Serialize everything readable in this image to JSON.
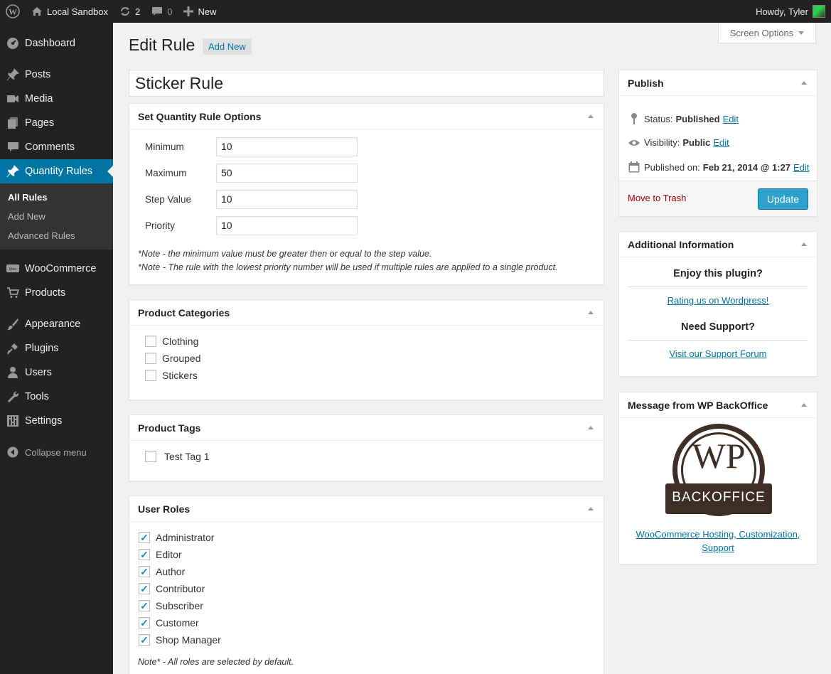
{
  "adminbar": {
    "site_name": "Local Sandbox",
    "updates_count": "2",
    "comments_count": "0",
    "new_label": "New",
    "howdy": "Howdy, Tyler"
  },
  "sidebar": {
    "items": [
      {
        "label": "Dashboard"
      },
      {
        "label": "Posts"
      },
      {
        "label": "Media"
      },
      {
        "label": "Pages"
      },
      {
        "label": "Comments"
      },
      {
        "label": "Quantity Rules"
      },
      {
        "label": "WooCommerce"
      },
      {
        "label": "Products"
      },
      {
        "label": "Appearance"
      },
      {
        "label": "Plugins"
      },
      {
        "label": "Users"
      },
      {
        "label": "Tools"
      },
      {
        "label": "Settings"
      }
    ],
    "submenu": [
      "All Rules",
      "Add New",
      "Advanced Rules"
    ],
    "collapse": "Collapse menu"
  },
  "header": {
    "screen_options": "Screen Options",
    "title": "Edit Rule",
    "add_new": "Add New"
  },
  "post_title": "Sticker Rule",
  "quantity_options": {
    "heading": "Set Quantity Rule Options",
    "fields": [
      {
        "label": "Minimum",
        "value": "10"
      },
      {
        "label": "Maximum",
        "value": "50"
      },
      {
        "label": "Step Value",
        "value": "10"
      },
      {
        "label": "Priority",
        "value": "10"
      }
    ],
    "note1": "*Note - the minimum value must be greater then or equal to the step value.",
    "note2": "*Note - The rule with the lowest priority number will be used if multiple rules are applied to a single product."
  },
  "categories": {
    "heading": "Product Categories",
    "items": [
      "Clothing",
      "Grouped",
      "Stickers"
    ]
  },
  "tags": {
    "heading": "Product Tags",
    "items": [
      "Test Tag 1"
    ]
  },
  "roles": {
    "heading": "User Roles",
    "items": [
      "Administrator",
      "Editor",
      "Author",
      "Contributor",
      "Subscriber",
      "Customer",
      "Shop Manager"
    ],
    "note": "Note* - All roles are selected by default."
  },
  "publish": {
    "heading": "Publish",
    "status_label": "Status:",
    "status_value": "Published",
    "visibility_label": "Visibility:",
    "visibility_value": "Public",
    "published_label": "Published on:",
    "published_value": "Feb 21, 2014 @ 1:27",
    "edit": "Edit",
    "trash": "Move to Trash",
    "update": "Update"
  },
  "additional": {
    "heading": "Additional Information",
    "enjoy": "Enjoy this plugin?",
    "rating_link": "Rating us on Wordpress!",
    "support": "Need Support?",
    "support_link": "Visit our Support Forum"
  },
  "backoffice": {
    "heading": "Message from WP BackOffice",
    "logo_wp": "WP",
    "logo_text": "BACKOFFICE",
    "link1": "WooCommerce Hosting, Customization,",
    "link2": "Support"
  },
  "colors": {
    "admin_dark": "#222222",
    "active_blue": "#0074a2",
    "button_blue": "#2ea2cc",
    "trash_red": "#aa0000",
    "logo_brown": "#3e2e26"
  }
}
